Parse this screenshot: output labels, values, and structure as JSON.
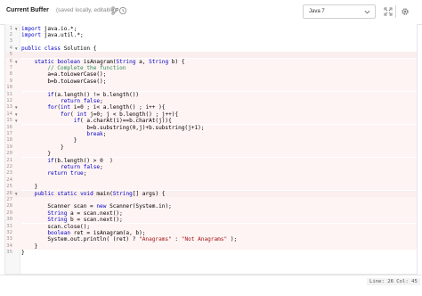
{
  "header": {
    "title": "Current Buffer",
    "subtitle": "(saved locally, editable)",
    "branch_icon": "branch-icon",
    "history_icon": "history-icon",
    "language_value": "Java 7",
    "expand_icon": "expand-icon",
    "settings_icon": "gear-icon"
  },
  "colors": {
    "keyword": "#0000c8",
    "comment": "#2e8b57",
    "string": "#a31515",
    "highlight_method1": "#fff4f4",
    "highlight_method2": "#fff4f4",
    "highlight_other": "#fbeeee"
  },
  "code": {
    "lines": [
      {
        "n": "1",
        "fold": "▼",
        "code": "import java.io.*;"
      },
      {
        "n": "2",
        "fold": "",
        "code": "import java.util.*;"
      },
      {
        "n": "3",
        "fold": "",
        "code": ""
      },
      {
        "n": "4",
        "fold": "▼",
        "code": "public class Solution {"
      },
      {
        "n": "5",
        "fold": "",
        "code": ""
      },
      {
        "n": "6",
        "fold": "▼",
        "code": "    static boolean isAnagram(String a, String b) {"
      },
      {
        "n": "7",
        "fold": "",
        "code": "        // Complete the function"
      },
      {
        "n": "8",
        "fold": "",
        "code": "        a=a.toLowerCase();"
      },
      {
        "n": "9",
        "fold": "",
        "code": "        b=b.toLowerCase();"
      },
      {
        "n": "10",
        "fold": "",
        "code": ""
      },
      {
        "n": "11",
        "fold": "",
        "code": "        if(a.length() != b.length())"
      },
      {
        "n": "12",
        "fold": "",
        "code": "            return false;"
      },
      {
        "n": "13",
        "fold": "▼",
        "code": "        for(int i=0 ; i< a.length() ; i++ ){"
      },
      {
        "n": "14",
        "fold": "▼",
        "code": "            for( int j=0; j < b.length() ; j++){"
      },
      {
        "n": "15",
        "fold": "▼",
        "code": "                if( a.charAt(i)==b.charAt(j)){"
      },
      {
        "n": "16",
        "fold": "",
        "code": "                    b=b.substring(0,j)+b.substring(j+1);"
      },
      {
        "n": "17",
        "fold": "",
        "code": "                    break;"
      },
      {
        "n": "18",
        "fold": "",
        "code": "                }"
      },
      {
        "n": "19",
        "fold": "",
        "code": "            }"
      },
      {
        "n": "20",
        "fold": "",
        "code": "        }"
      },
      {
        "n": "21",
        "fold": "",
        "code": "        if(b.length() > 0  )"
      },
      {
        "n": "22",
        "fold": "",
        "code": "            return false;"
      },
      {
        "n": "23",
        "fold": "",
        "code": "        return true;"
      },
      {
        "n": "24",
        "fold": "",
        "code": ""
      },
      {
        "n": "25",
        "fold": "",
        "code": "    }"
      },
      {
        "n": "26",
        "fold": "▼",
        "code": "    public static void main(String[] args) {"
      },
      {
        "n": "27",
        "fold": "",
        "code": ""
      },
      {
        "n": "28",
        "fold": "",
        "code": "        Scanner scan = new Scanner(System.in);"
      },
      {
        "n": "29",
        "fold": "",
        "code": "        String a = scan.next();"
      },
      {
        "n": "30",
        "fold": "",
        "code": "        String b = scan.next();"
      },
      {
        "n": "31",
        "fold": "",
        "code": "        scan.close();"
      },
      {
        "n": "32",
        "fold": "",
        "code": "        boolean ret = isAnagram(a, b);"
      },
      {
        "n": "33",
        "fold": "",
        "code": "        System.out.println( (ret) ? \"Anagrams\" : \"Not Anagrams\" );"
      },
      {
        "n": "34",
        "fold": "",
        "code": "    }"
      },
      {
        "n": "35",
        "fold": "",
        "code": "}"
      }
    ]
  },
  "status": {
    "cursor": "Line: 26 Col: 45"
  }
}
